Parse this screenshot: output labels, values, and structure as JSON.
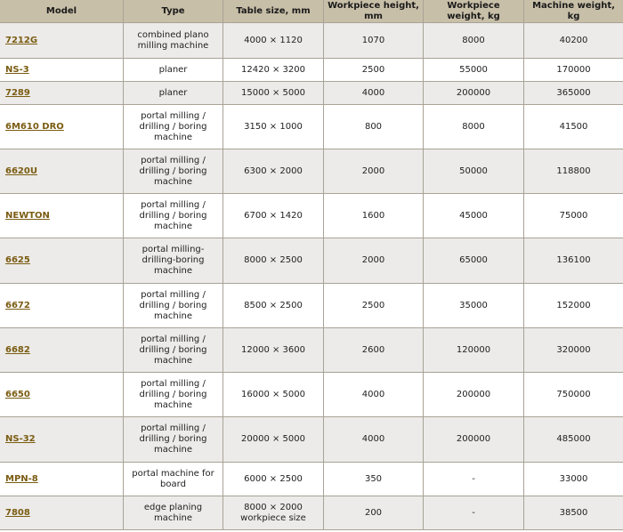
{
  "headers": [
    "Model",
    "Type",
    "Table size, mm",
    "Workpiece height, mm",
    "Workpiece weight, kg",
    "Machine weight, kg"
  ],
  "rows": [
    {
      "model": "7212G",
      "type": "combined plano milling machine",
      "table": "4000 × 1120",
      "height": "1070",
      "wp_weight": "8000",
      "m_weight": "40200"
    },
    {
      "model": "NS-3",
      "type": "planer",
      "table": "12420 × 3200",
      "height": "2500",
      "wp_weight": "55000",
      "m_weight": "170000"
    },
    {
      "model": "7289",
      "type": "planer",
      "table": "15000 × 5000",
      "height": "4000",
      "wp_weight": "200000",
      "m_weight": "365000"
    },
    {
      "model": "6M610 DRO",
      "type": "portal milling / drilling / boring machine",
      "table": "3150 × 1000",
      "height": "800",
      "wp_weight": "8000",
      "m_weight": "41500"
    },
    {
      "model": "6620U",
      "type": "portal milling / drilling / boring machine",
      "table": "6300 × 2000",
      "height": "2000",
      "wp_weight": "50000",
      "m_weight": "118800"
    },
    {
      "model": "NEWTON",
      "type": "portal milling / drilling / boring machine",
      "table": "6700 × 1420",
      "height": "1600",
      "wp_weight": "45000",
      "m_weight": "75000"
    },
    {
      "model": "6625",
      "type": "portal milling-drilling-boring machine",
      "table": "8000 × 2500",
      "height": "2000",
      "wp_weight": "65000",
      "m_weight": "136100"
    },
    {
      "model": "6672",
      "type": "portal milling / drilling / boring machine",
      "table": "8500 × 2500",
      "height": "2500",
      "wp_weight": "35000",
      "m_weight": "152000"
    },
    {
      "model": "6682",
      "type": "portal milling / drilling / boring machine",
      "table": "12000 × 3600",
      "height": "2600",
      "wp_weight": "120000",
      "m_weight": "320000"
    },
    {
      "model": "6650",
      "type": "portal milling / drilling / boring machine",
      "table": "16000 × 5000",
      "height": "4000",
      "wp_weight": "200000",
      "m_weight": "750000"
    },
    {
      "model": "NS-32",
      "type": "portal milling / drilling / boring machine",
      "table": "20000 × 5000",
      "height": "4000",
      "wp_weight": "200000",
      "m_weight": "485000"
    },
    {
      "model": "MPN-8",
      "type": "portal machine for board",
      "table": "6000 × 2500",
      "height": "350",
      "wp_weight": "-",
      "m_weight": "33000"
    },
    {
      "model": "7808",
      "type": "edge planing machine",
      "table": "8000 × 2000 workpiece size",
      "height": "200",
      "wp_weight": "-",
      "m_weight": "38500"
    }
  ]
}
